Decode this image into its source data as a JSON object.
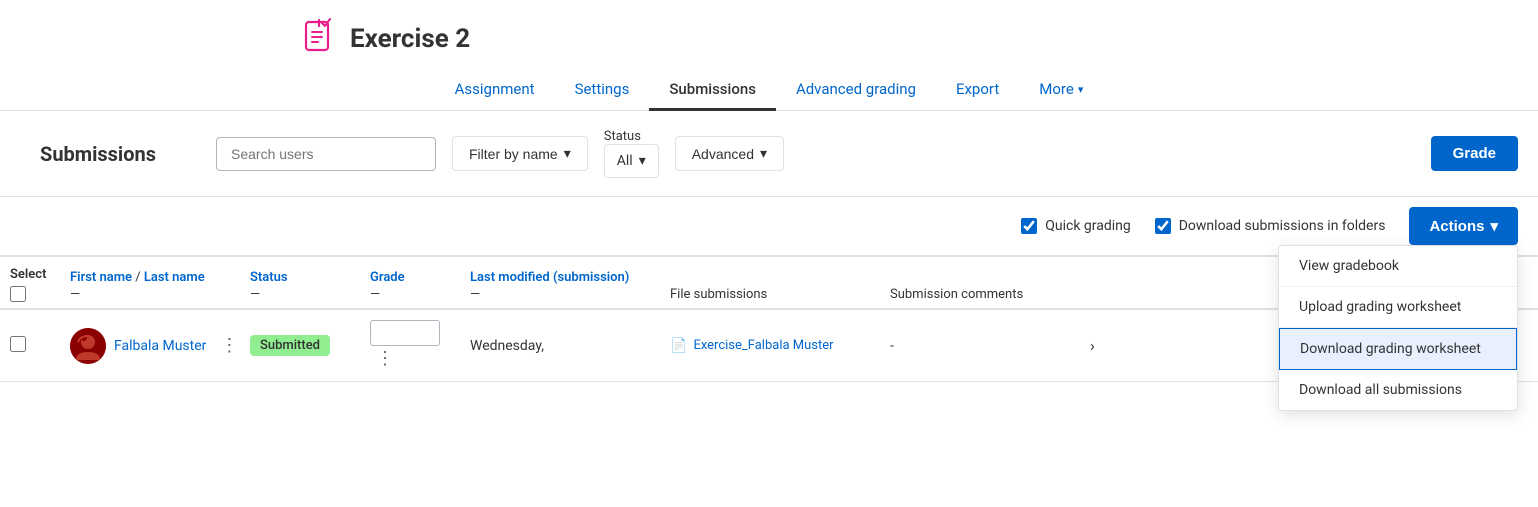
{
  "header": {
    "title": "Exercise 2",
    "icon_label": "assignment-icon"
  },
  "nav": {
    "tabs": [
      {
        "label": "Assignment",
        "active": false
      },
      {
        "label": "Settings",
        "active": false
      },
      {
        "label": "Submissions",
        "active": true
      },
      {
        "label": "Advanced grading",
        "active": false
      },
      {
        "label": "Export",
        "active": false
      },
      {
        "label": "More",
        "active": false,
        "has_dropdown": true
      }
    ]
  },
  "submissions_bar": {
    "title": "Submissions",
    "search_placeholder": "Search users",
    "filter_by_name_label": "Filter by name",
    "status_label": "Status",
    "status_value": "All",
    "advanced_label": "Advanced",
    "grade_button": "Grade"
  },
  "options_row": {
    "quick_grading_label": "Quick grading",
    "quick_grading_checked": true,
    "download_folders_label": "Download submissions in folders",
    "download_folders_checked": true,
    "actions_button": "Actions"
  },
  "dropdown_menu": {
    "items": [
      {
        "label": "View gradebook",
        "highlighted": false
      },
      {
        "label": "Upload grading worksheet",
        "highlighted": false
      },
      {
        "label": "Download grading worksheet",
        "highlighted": true
      },
      {
        "label": "Download all submissions",
        "highlighted": false
      }
    ]
  },
  "table": {
    "columns": [
      {
        "label": "Select",
        "sort": false
      },
      {
        "label": "First name / Last name",
        "sort": true,
        "dash": "—"
      },
      {
        "label": "Status",
        "sort": true,
        "dash": "—"
      },
      {
        "label": "Grade",
        "sort": true,
        "dash": "—"
      },
      {
        "label": "Last modified (submission)",
        "sort": true,
        "dash": "—"
      },
      {
        "label": "File submissions",
        "sort": false
      },
      {
        "label": "Submission comments",
        "sort": false
      },
      {
        "label": "",
        "sort": false
      }
    ],
    "rows": [
      {
        "selected": false,
        "name": "Falbala Muster",
        "status": "Submitted",
        "grade": "",
        "last_modified": "Wednesday,",
        "file_name": "Exercise_Falbala Muster",
        "comments": "-",
        "has_arrow": true
      }
    ]
  }
}
